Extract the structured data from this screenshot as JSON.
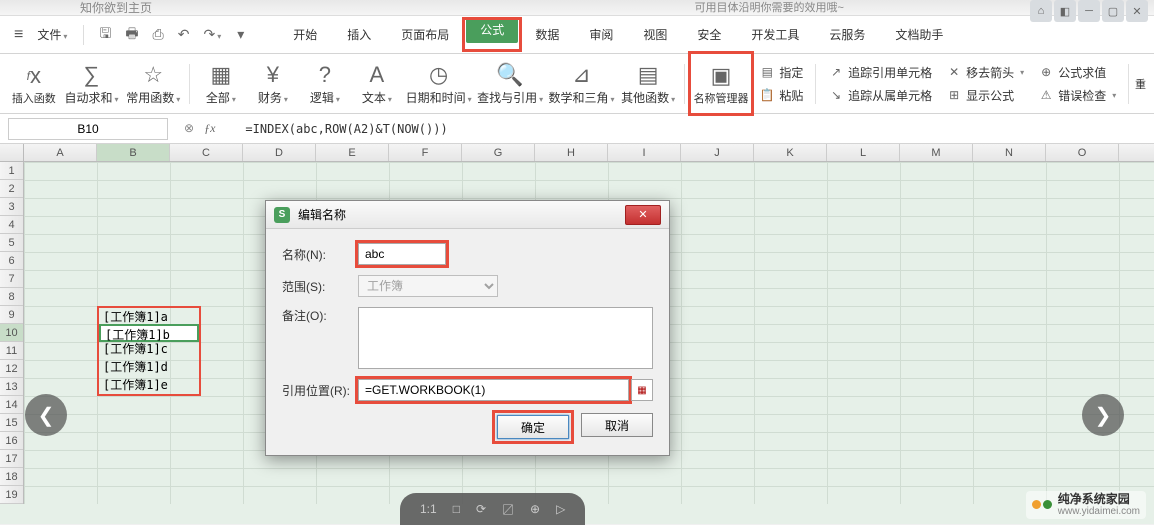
{
  "top_faded_left": "知你欲到主页",
  "top_faded_right": "可用目体沿明你需要的效用哦~",
  "file_menu": "文件",
  "menu_tabs": [
    "开始",
    "插入",
    "页面布局",
    "公式",
    "数据",
    "审阅",
    "视图",
    "安全",
    "开发工具",
    "云服务",
    "文档助手"
  ],
  "active_tab_index": 3,
  "ribbon": {
    "insert_func": "插入函数",
    "auto_sum": "自动求和",
    "common": "常用函数",
    "all": "全部",
    "finance": "财务",
    "logic": "逻辑",
    "text": "文本",
    "datetime": "日期和时间",
    "lookup": "查找与引用",
    "math": "数学和三角",
    "other": "其他函数",
    "name_mgr": "名称管理器",
    "assign": "指定",
    "paste": "粘贴",
    "trace_prec": "追踪引用单元格",
    "trace_dep": "追踪从属单元格",
    "remove_arrows": "移去箭头",
    "show_formula": "显示公式",
    "eval": "公式求值",
    "error_check": "错误检查",
    "more": "重"
  },
  "name_box": "B10",
  "formula": "=INDEX(abc,ROW(A2)&T(NOW()))",
  "columns": [
    "A",
    "B",
    "C",
    "D",
    "E",
    "F",
    "G",
    "H",
    "I",
    "J",
    "K",
    "L",
    "M",
    "N",
    "O"
  ],
  "rows_count": 19,
  "active_row": 10,
  "active_col": 1,
  "data_cells": [
    "[工作簿1]a",
    "[工作簿1]b",
    "[工作簿1]c",
    "[工作簿1]d",
    "[工作簿1]e"
  ],
  "dialog": {
    "title": "编辑名称",
    "name_label": "名称(N):",
    "name_value": "abc",
    "scope_label": "范围(S):",
    "scope_value": "工作簿",
    "remarks_label": "备注(O):",
    "remarks_value": "",
    "ref_label": "引用位置(R):",
    "ref_value": "=GET.WORKBOOK(1)",
    "ok": "确定",
    "cancel": "取消"
  },
  "bottom_toolbar": [
    "1:1",
    "□",
    "⟳",
    "〼",
    "⊕",
    "▷"
  ],
  "watermark": {
    "line1": "纯净系统家园",
    "line2": "www.yidaimei.com"
  }
}
